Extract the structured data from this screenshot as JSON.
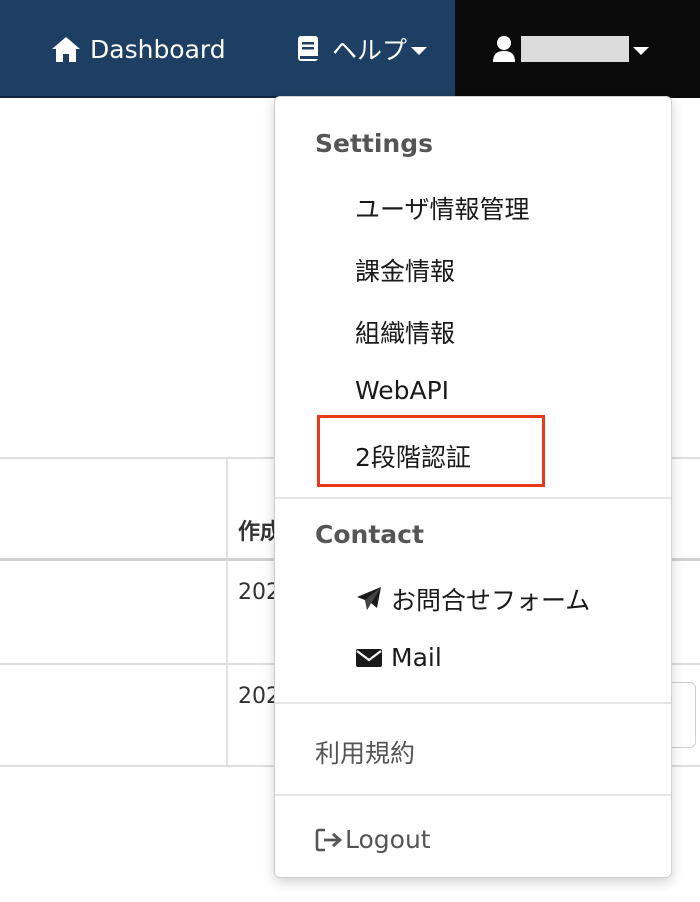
{
  "navbar": {
    "dashboard_label": "Dashboard",
    "help_label": "ヘルプ",
    "user_label": "",
    "colors": {
      "background": "#1c3f63",
      "user_background": "#0b0b0b"
    },
    "icons": {
      "dashboard": "home-icon",
      "help": "book-icon",
      "user": "user-icon",
      "dropdown": "caret-down-icon"
    }
  },
  "background_table": {
    "header_partial": "作成",
    "rows_partial": [
      "202",
      "202"
    ]
  },
  "dropdown": {
    "settings_header": "Settings",
    "settings_items": [
      "ユーザ情報管理",
      "課金情報",
      "組織情報",
      "WebAPI",
      "2段階認証"
    ],
    "highlighted_item": "2段階認証",
    "highlight_color": "#e8391d",
    "contact_header": "Contact",
    "contact_items": [
      {
        "label": "お問合せフォーム",
        "icon": "paper-plane-icon"
      },
      {
        "label": "Mail",
        "icon": "envelope-icon"
      }
    ],
    "terms_label": "利用規約",
    "logout_label": "Logout",
    "logout_icon": "sign-out-icon"
  }
}
